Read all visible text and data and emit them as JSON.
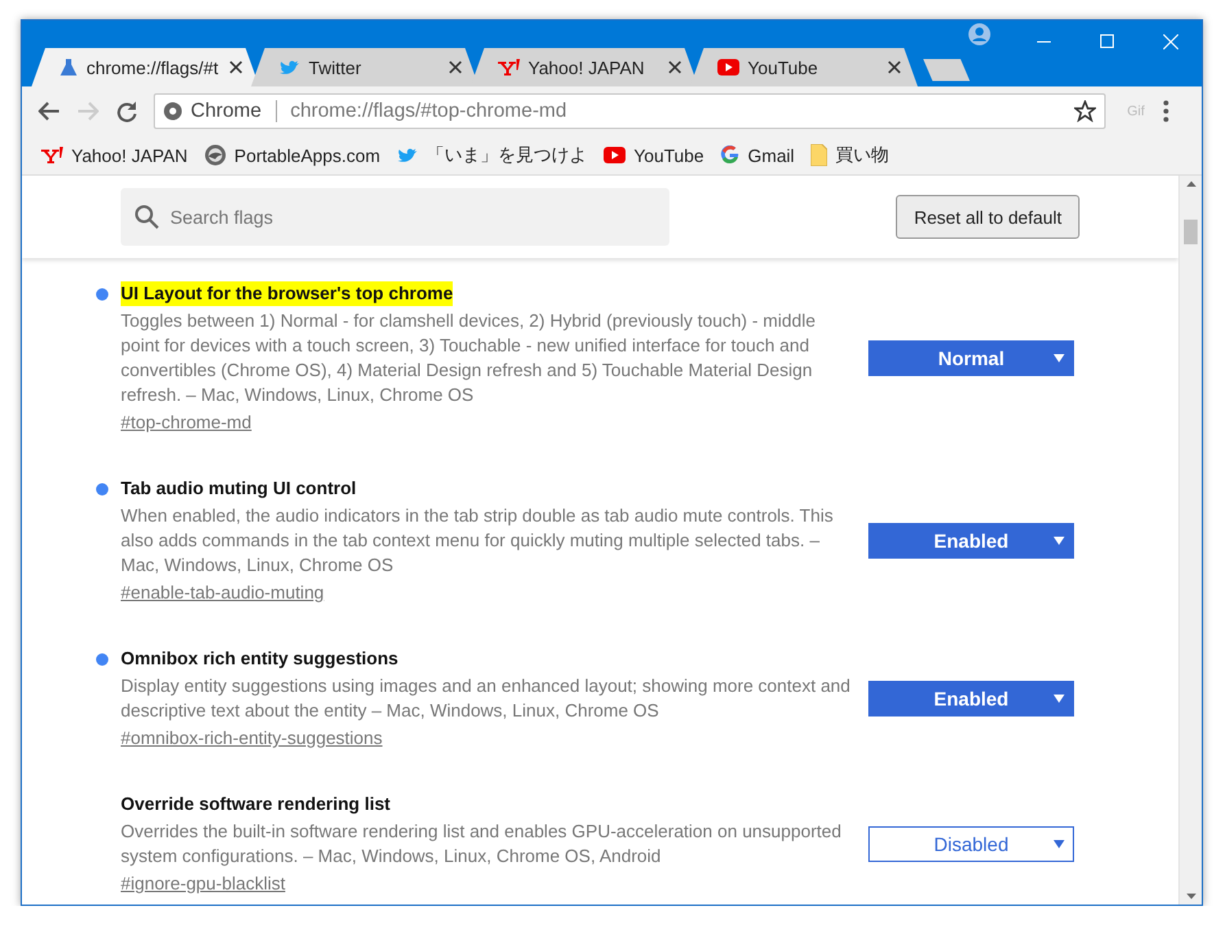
{
  "tabs": [
    {
      "title": "chrome://flags/#t",
      "selected": true
    },
    {
      "title": "Twitter",
      "selected": false
    },
    {
      "title": "Yahoo! JAPAN",
      "selected": false
    },
    {
      "title": "YouTube",
      "selected": false
    }
  ],
  "omnibox": {
    "site": "Chrome",
    "url": "chrome://flags/#top-chrome-md"
  },
  "extension": {
    "label": "Gif"
  },
  "bookmarks": [
    {
      "label": "Yahoo! JAPAN"
    },
    {
      "label": "PortableApps.com"
    },
    {
      "label": "「いま」を見つけよ"
    },
    {
      "label": "YouTube"
    },
    {
      "label": "Gmail"
    },
    {
      "label": "買い物"
    }
  ],
  "search": {
    "placeholder": "Search flags"
  },
  "reset_button": {
    "label": "Reset all to default"
  },
  "flags": [
    {
      "title": "UI Layout for the browser's top chrome",
      "highlighted": true,
      "modified": true,
      "description": "Toggles between 1) Normal - for clamshell devices, 2) Hybrid (previously touch) - middle point for devices with a touch screen, 3) Touchable - new unified interface for touch and convertibles (Chrome OS), 4) Material Design refresh and 5) Touchable Material Design refresh. – Mac, Windows, Linux, Chrome OS",
      "link": "#top-chrome-md",
      "value": "Normal"
    },
    {
      "title": "Tab audio muting UI control",
      "highlighted": false,
      "modified": true,
      "description": "When enabled, the audio indicators in the tab strip double as tab audio mute controls. This also adds commands in the tab context menu for quickly muting multiple selected tabs. – Mac, Windows, Linux, Chrome OS",
      "link": "#enable-tab-audio-muting",
      "value": "Enabled"
    },
    {
      "title": "Omnibox rich entity suggestions",
      "highlighted": false,
      "modified": true,
      "description": "Display entity suggestions using images and an enhanced layout; showing more context and descriptive text about the entity – Mac, Windows, Linux, Chrome OS",
      "link": "#omnibox-rich-entity-suggestions",
      "value": "Enabled"
    },
    {
      "title": "Override software rendering list",
      "highlighted": false,
      "modified": false,
      "description": "Overrides the built-in software rendering list and enables GPU-acceleration on unsupported system configurations. – Mac, Windows, Linux, Chrome OS, Android",
      "link": "#ignore-gpu-blacklist",
      "value": "Disabled"
    }
  ]
}
